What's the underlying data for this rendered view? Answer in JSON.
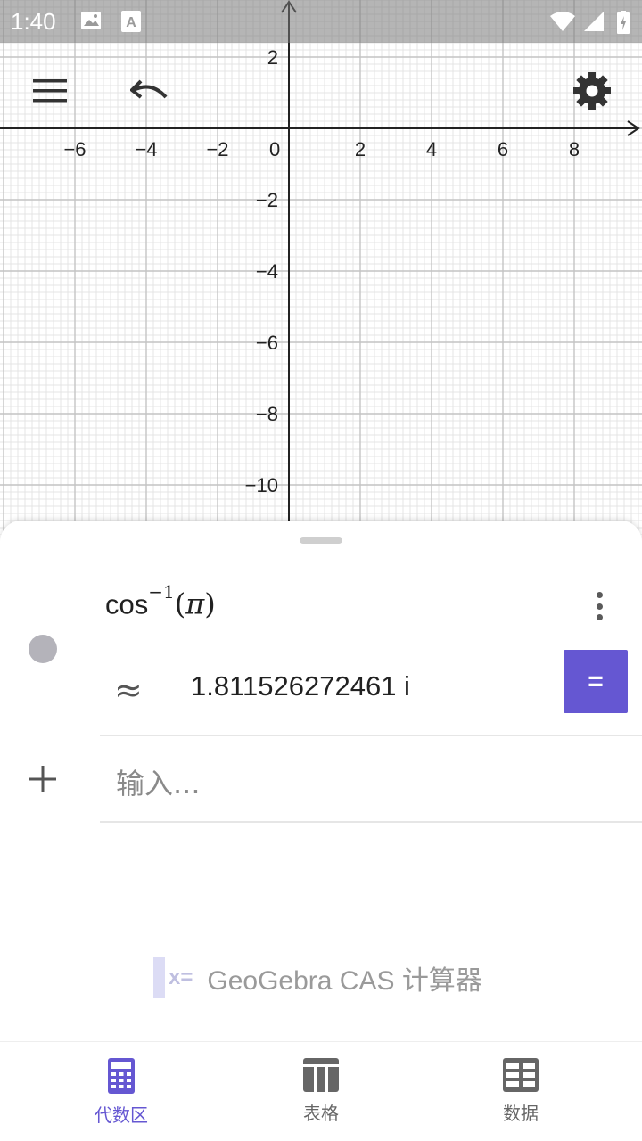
{
  "status_bar": {
    "time": "1:40",
    "icons": [
      "image-icon",
      "font-icon",
      "wifi-icon",
      "signal-icon",
      "battery-charging-icon"
    ]
  },
  "toolbar": {
    "menu_icon": "hamburger-menu-icon",
    "undo_icon": "undo-icon",
    "settings_icon": "gear-icon"
  },
  "graph": {
    "x_ticks": [
      "−6",
      "−4",
      "−2",
      "0",
      "2",
      "4",
      "6",
      "8"
    ],
    "y_ticks": [
      "2",
      "−2",
      "−4",
      "−6",
      "−8",
      "−10"
    ]
  },
  "algebra": {
    "entries": [
      {
        "input_fn": "cos",
        "input_exp": "−1",
        "input_arg_open": "(",
        "input_arg": "π",
        "input_arg_close": ")",
        "approx_symbol": "≈",
        "result": "1.811526272461 i",
        "eq_button_label": "="
      }
    ],
    "input_placeholder": "输入...",
    "brand_icon_text": "x=",
    "brand_text": "GeoGebra CAS 计算器"
  },
  "colors": {
    "accent": "#6557d2",
    "grid_minor": "#e4e4e4",
    "grid_major": "#c4c4c4",
    "axis": "#222222"
  },
  "bottom_nav": {
    "items": [
      {
        "label": "代数区",
        "icon": "calculator-icon",
        "active": true
      },
      {
        "label": "表格",
        "icon": "table-icon",
        "active": false
      },
      {
        "label": "数据",
        "icon": "spreadsheet-icon",
        "active": false
      }
    ]
  }
}
